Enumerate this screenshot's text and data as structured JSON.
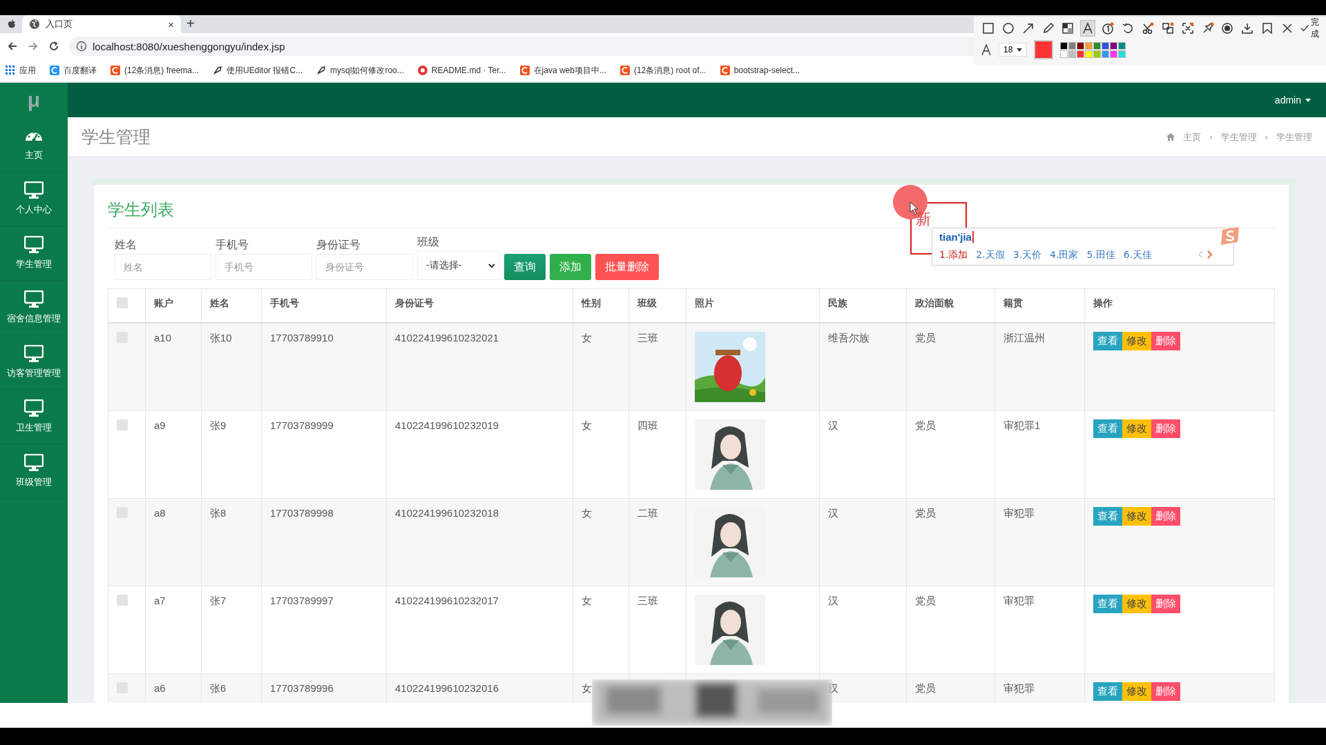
{
  "browser": {
    "tabs": [
      {
        "title": "入口页",
        "close": "×",
        "selected": true
      }
    ],
    "new_tab": "+",
    "url": "localhost:8080/xueshenggongyu/index.jsp",
    "bookmarks": [
      {
        "label": "应用",
        "kind": "apps",
        "color": "#1a73e8"
      },
      {
        "label": "百度翻译",
        "kind": "square",
        "color": "#2196f3"
      },
      {
        "label": "(12条消息) freema...",
        "kind": "square",
        "color": "#f4511e"
      },
      {
        "label": "使用UEditor 报错C...",
        "kind": "feather",
        "color": "#333333"
      },
      {
        "label": "mysql如何修改roo...",
        "kind": "feather",
        "color": "#333333"
      },
      {
        "label": "README.md · Ter...",
        "kind": "circle",
        "color": "#e53935"
      },
      {
        "label": "在java web项目中...",
        "kind": "square",
        "color": "#f4511e"
      },
      {
        "label": "(12条消息) root of...",
        "kind": "square",
        "color": "#f4511e"
      },
      {
        "label": "bootstrap-select...",
        "kind": "square",
        "color": "#f4511e"
      }
    ]
  },
  "annotation_toolbar": {
    "tools": [
      {
        "kind": "rect",
        "selected": false
      },
      {
        "kind": "ellipse",
        "selected": false
      },
      {
        "kind": "arrow",
        "selected": false
      },
      {
        "kind": "pencil",
        "selected": false
      },
      {
        "kind": "mosaic",
        "selected": false
      },
      {
        "kind": "text",
        "selected": true
      },
      {
        "kind": "number",
        "selected": false
      },
      {
        "kind": "undo",
        "selected": false
      },
      {
        "kind": "scissors",
        "selected": false
      },
      {
        "kind": "translate",
        "selected": false
      },
      {
        "kind": "expand",
        "selected": false
      },
      {
        "kind": "pin",
        "selected": false
      },
      {
        "kind": "record",
        "selected": false
      },
      {
        "kind": "download",
        "selected": false
      },
      {
        "kind": "bookmark",
        "selected": false
      },
      {
        "kind": "close",
        "selected": false
      }
    ],
    "done": "完成",
    "font_size": "18",
    "current": {
      "color": "#ff3333"
    },
    "palette": [
      {
        "color": "#000000"
      },
      {
        "color": "#808080"
      },
      {
        "color": "#800000"
      },
      {
        "color": "#f39c3c"
      },
      {
        "color": "#2e8b2e"
      },
      {
        "color": "#3050e0"
      },
      {
        "color": "#800080"
      },
      {
        "color": "#008b8b"
      },
      {
        "color": "#ffffff"
      },
      {
        "color": "#c0c0c0"
      },
      {
        "color": "#ff3333"
      },
      {
        "color": "#ffff00"
      },
      {
        "color": "#99cc00"
      },
      {
        "color": "#3399ee"
      },
      {
        "color": "#ff33ff"
      },
      {
        "color": "#22dddd"
      }
    ]
  },
  "sidebar": {
    "logo": "μ",
    "items": [
      {
        "label": "主页",
        "kind": "dashboard",
        "selected": false
      },
      {
        "label": "个人中心",
        "kind": "monitor",
        "selected": false
      },
      {
        "label": "学生管理",
        "kind": "monitor",
        "selected": false
      },
      {
        "label": "宿舍信息管理",
        "kind": "monitor",
        "selected": false
      },
      {
        "label": "访客管理管理",
        "kind": "monitor",
        "selected": false
      },
      {
        "label": "卫生管理",
        "kind": "monitor",
        "selected": false
      },
      {
        "label": "班级管理",
        "kind": "monitor",
        "selected": false
      }
    ]
  },
  "topbar": {
    "user": "admin"
  },
  "page_header": {
    "title": "学生管理",
    "breadcrumb": [
      "主页",
      "学生管理",
      "学生管理"
    ],
    "separator": "›"
  },
  "card": {
    "title": "学生列表",
    "filters": [
      {
        "label": "姓名",
        "placeholder": "姓名"
      },
      {
        "label": "手机号",
        "placeholder": "手机号"
      },
      {
        "label": "身份证号",
        "placeholder": "身份证号"
      }
    ],
    "class_select": {
      "label": "班级",
      "value": "-请选择-"
    },
    "buttons": [
      {
        "label": "查询",
        "kind": "search"
      },
      {
        "label": "添加",
        "kind": "add"
      },
      {
        "label": "批量删除",
        "kind": "danger"
      }
    ]
  },
  "table": {
    "select_all": {
      "checked": false
    },
    "columns": [
      "账户",
      "姓名",
      "手机号",
      "身份证号",
      "性别",
      "班级",
      "照片",
      "民族",
      "政治面貌",
      "籍贯",
      "操作"
    ],
    "rows": [
      {
        "checked": false,
        "cells": [
          "a10",
          "张10",
          "17703789910",
          "410224199610232021",
          "女",
          "三班"
        ],
        "photo": {
          "kind": "picture"
        },
        "rest": [
          "维吾尔族",
          "党员",
          "浙江温州"
        ],
        "actions": [
          {
            "label": "查看",
            "kind": "view"
          },
          {
            "label": "修改",
            "kind": "edit"
          },
          {
            "label": "删除",
            "kind": "delete"
          }
        ]
      },
      {
        "checked": false,
        "cells": [
          "a9",
          "张9",
          "17703789999",
          "410224199610232019",
          "女",
          "四班"
        ],
        "photo": {
          "kind": "picture"
        },
        "rest": [
          "汉",
          "党员",
          "审犯罪1"
        ],
        "actions": [
          {
            "label": "查看",
            "kind": "view"
          },
          {
            "label": "修改",
            "kind": "edit"
          },
          {
            "label": "删除",
            "kind": "delete"
          }
        ]
      },
      {
        "checked": false,
        "cells": [
          "a8",
          "张8",
          "17703789998",
          "410224199610232018",
          "女",
          "二班"
        ],
        "photo": {
          "kind": "picture"
        },
        "rest": [
          "汉",
          "党员",
          "审犯罪"
        ],
        "actions": [
          {
            "label": "查看",
            "kind": "view"
          },
          {
            "label": "修改",
            "kind": "edit"
          },
          {
            "label": "删除",
            "kind": "delete"
          }
        ]
      },
      {
        "checked": false,
        "cells": [
          "a7",
          "张7",
          "17703789997",
          "410224199610232017",
          "女",
          "三班"
        ],
        "photo": {
          "kind": "picture"
        },
        "rest": [
          "汉",
          "党员",
          "审犯罪"
        ],
        "actions": [
          {
            "label": "查看",
            "kind": "view"
          },
          {
            "label": "修改",
            "kind": "edit"
          },
          {
            "label": "删除",
            "kind": "delete"
          }
        ]
      },
      {
        "checked": false,
        "cells": [
          "a6",
          "张6",
          "17703789996",
          "410224199610232016",
          "女"
        ],
        "rest": [
          "汉",
          "党员",
          "审犯罪"
        ],
        "actions": [
          {
            "label": "查看",
            "kind": "view"
          },
          {
            "label": "修改",
            "kind": "edit"
          },
          {
            "label": "删除",
            "kind": "delete"
          }
        ]
      }
    ]
  },
  "ime": {
    "composition": "tian'jia",
    "candidates": [
      {
        "label": "1.添加",
        "selected": true
      },
      {
        "label": "2.天假",
        "selected": false
      },
      {
        "label": "3.天价",
        "selected": false
      },
      {
        "label": "4.田家",
        "selected": false
      },
      {
        "label": "5.田佳",
        "selected": false
      },
      {
        "label": "6.天佳",
        "selected": false
      }
    ]
  },
  "annotation": {
    "text": "新"
  },
  "blur_overlay": true
}
